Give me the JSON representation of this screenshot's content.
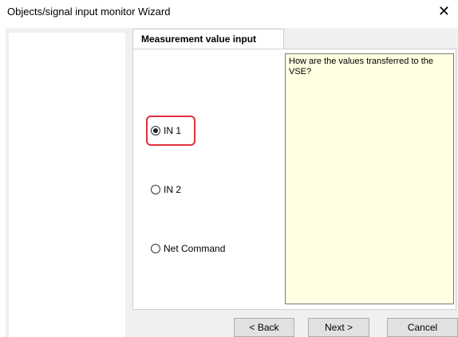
{
  "window": {
    "title": "Objects/signal input monitor Wizard",
    "close_glyph": "✕"
  },
  "tab": {
    "label": "Measurement value input"
  },
  "help": {
    "text": "How are the values transferred to the VSE?"
  },
  "options": [
    {
      "label": "IN 1",
      "selected": true
    },
    {
      "label": "IN 2",
      "selected": false
    },
    {
      "label": "Net Command",
      "selected": false
    }
  ],
  "buttons": {
    "back": "< Back",
    "next": "Next >",
    "cancel": "Cancel"
  },
  "colors": {
    "help_bg": "#ffffe1",
    "highlight": "#e0303a"
  }
}
